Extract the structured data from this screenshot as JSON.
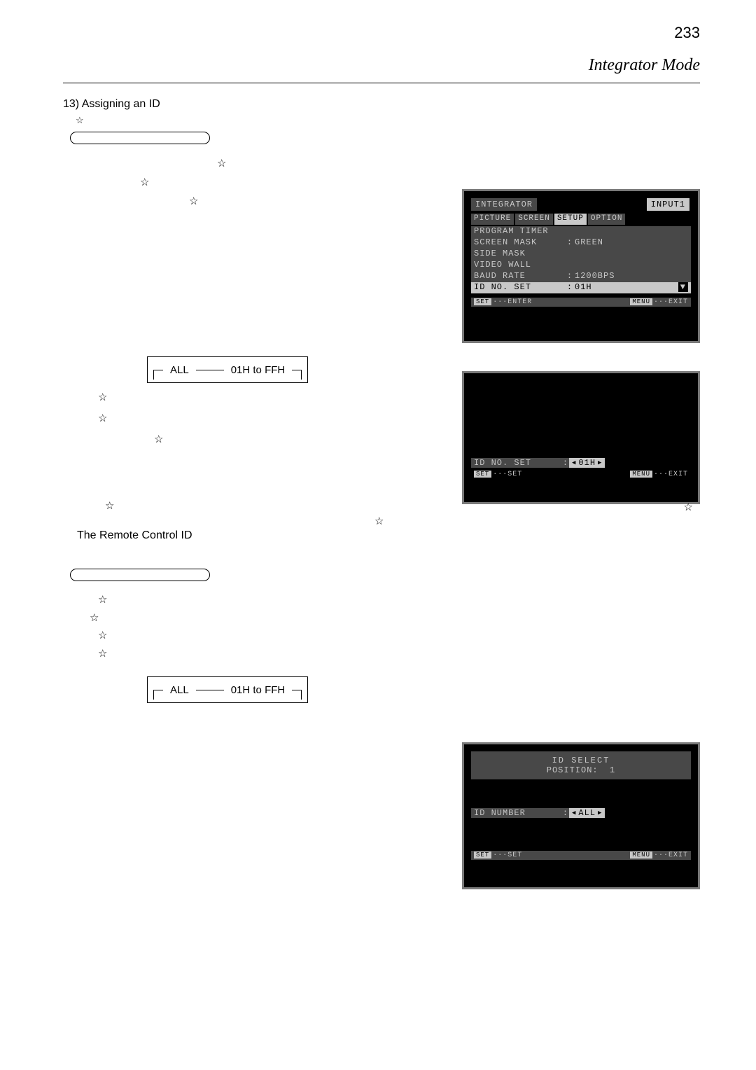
{
  "header": {
    "title": "Integrator Mode"
  },
  "section13": {
    "heading": "13) Assigning an ID",
    "star1": "☆",
    "box": "",
    "note1a": "☆",
    "note1b": "☆",
    "note1c": "☆",
    "cycle": {
      "left": "ALL",
      "right": "01H to FFH"
    },
    "star2": "☆",
    "star3": "☆",
    "star4": "☆",
    "star5": "☆",
    "star_left": "☆",
    "star_right": "☆"
  },
  "osd1": {
    "title": "INTEGRATOR",
    "input": "INPUT1",
    "tabs": [
      "PICTURE",
      "SCREEN",
      "SETUP",
      "OPTION"
    ],
    "rows": [
      {
        "k": "PROGRAM TIMER",
        "c": "",
        "v": ""
      },
      {
        "k": "SCREEN MASK",
        "c": ":",
        "v": "GREEN"
      },
      {
        "k": "SIDE MASK",
        "c": "",
        "v": ""
      },
      {
        "k": "VIDEO WALL",
        "c": "",
        "v": ""
      },
      {
        "k": "BAUD RATE",
        "c": ":",
        "v": "1200BPS"
      }
    ],
    "sel": {
      "k": "ID NO. SET",
      "c": ":",
      "v": "01H"
    },
    "foot_l": "SET",
    "foot_l2": "···ENTER",
    "foot_r": "MENU",
    "foot_r2": "···EXIT"
  },
  "osd2": {
    "sel": {
      "k": "ID NO. SET",
      "c": ":",
      "v": "01H"
    },
    "foot_l": "SET",
    "foot_l2": "···SET",
    "foot_r": "MENU",
    "foot_r2": "···EXIT"
  },
  "remote": {
    "heading": "The Remote Control ID",
    "box": "",
    "star1": "☆",
    "star2": "☆",
    "star3": "☆",
    "star4": "☆",
    "cycle": {
      "left": "ALL",
      "right": "01H to FFH"
    }
  },
  "osd3": {
    "title": "ID SELECT",
    "pos_label": "POSITION:",
    "pos_val": "1",
    "sel": {
      "k": "ID NUMBER",
      "c": ":",
      "v": "ALL"
    },
    "foot_l": "SET",
    "foot_l2": "···SET",
    "foot_r": "MENU",
    "foot_r2": "···EXIT"
  },
  "pageNumber": "233"
}
